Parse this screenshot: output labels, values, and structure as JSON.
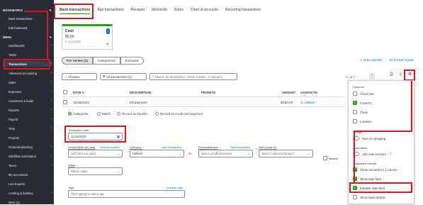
{
  "sidebar": {
    "bookmarks": "BOOKMARKS",
    "bank_transactions": "Bank transactions",
    "edit_bookmark": "Edit bookmark",
    "menu": "MENU",
    "items": [
      "Dashboards",
      "Tasks",
      "Transactions",
      "Advanced accounting",
      "Sales",
      "Expenses",
      "Customers & leads",
      "Reports",
      "Payroll",
      "Time",
      "Projects",
      "Financial planning",
      "Workflow automation",
      "Taxes",
      "My accountant",
      "Live Experts",
      "Lending & banking",
      "More (1)"
    ]
  },
  "topnav": [
    "Bank transactions",
    "App transactions",
    "Receipts",
    "Reconcile",
    "Rules",
    "Chart of accounts",
    "Recurring transactions"
  ],
  "card": {
    "title": "Cash",
    "amount": "$0.00",
    "date": "11/17/2023",
    "badge": "1"
  },
  "subtabs": [
    "For review (1)",
    "Categorized",
    "Excluded"
  ],
  "links": {
    "video": "Video tutorials",
    "go_to_bank": "Go to bank register"
  },
  "filters": {
    "dates": "All dates",
    "transactions": "All transactions (1)",
    "search_placeholder": "Search by description, check number, or amount"
  },
  "pagination": "1-1 of 1",
  "table": {
    "headers": [
      "DATE",
      "DESCRIPTION",
      "FROM/TO",
      "AMOUNT",
      "ASSIGN TO"
    ],
    "row": {
      "date": "11/16/2023",
      "description": "bill payment",
      "amount": "-$160.00",
      "assign": "Utilities"
    }
  },
  "radios": [
    "Categorize",
    "Match",
    "Record as transfer",
    "Record as credit card payment"
  ],
  "form": {
    "transaction_date_label": "Transaction date",
    "transaction_date": "11/16/2023",
    "vendor_label": "Vendor/Who you paid",
    "vendor_placeholder": "Add who you paid",
    "split_transaction": "Split transaction",
    "category_label": "Category *",
    "category_value": "Utilities",
    "or": "or",
    "product_label": "Product/service",
    "product_placeholder": "Select product/service",
    "customer_label": "Who it was for",
    "customer_placeholder": "Select customer/project",
    "billable": "Billable",
    "class_label": "Class",
    "class_placeholder": "Select class",
    "tags_label": "Tags",
    "manage_tags": "Manage tags",
    "tags_placeholder": "Start typing to add a tag"
  },
  "panel": {
    "columns_label": "Columns",
    "columns": [
      {
        "label": "Check No.",
        "checked": false
      },
      {
        "label": "From/To",
        "checked": true
      },
      {
        "label": "Class",
        "checked": false
      },
      {
        "label": "Location",
        "checked": false
      }
    ],
    "groups_label": "Groups",
    "groups_toggle": "Turn on grouping",
    "automation_label": "Automation",
    "automation_toggle": "Add new vendors",
    "details_label": "Transaction details",
    "details": [
      {
        "label": "Show amounts in 1 column",
        "checked": true
      },
      {
        "label": "Show tags field",
        "checked": true
      },
      {
        "label": "Editable date field",
        "checked": true
      },
      {
        "label": "Show bank details",
        "checked": false
      }
    ]
  },
  "colors": {
    "accent_green": "#2ca01c",
    "highlight_red": "#e0141e",
    "sidebar": "#262b34",
    "link_blue": "#0077c5"
  }
}
